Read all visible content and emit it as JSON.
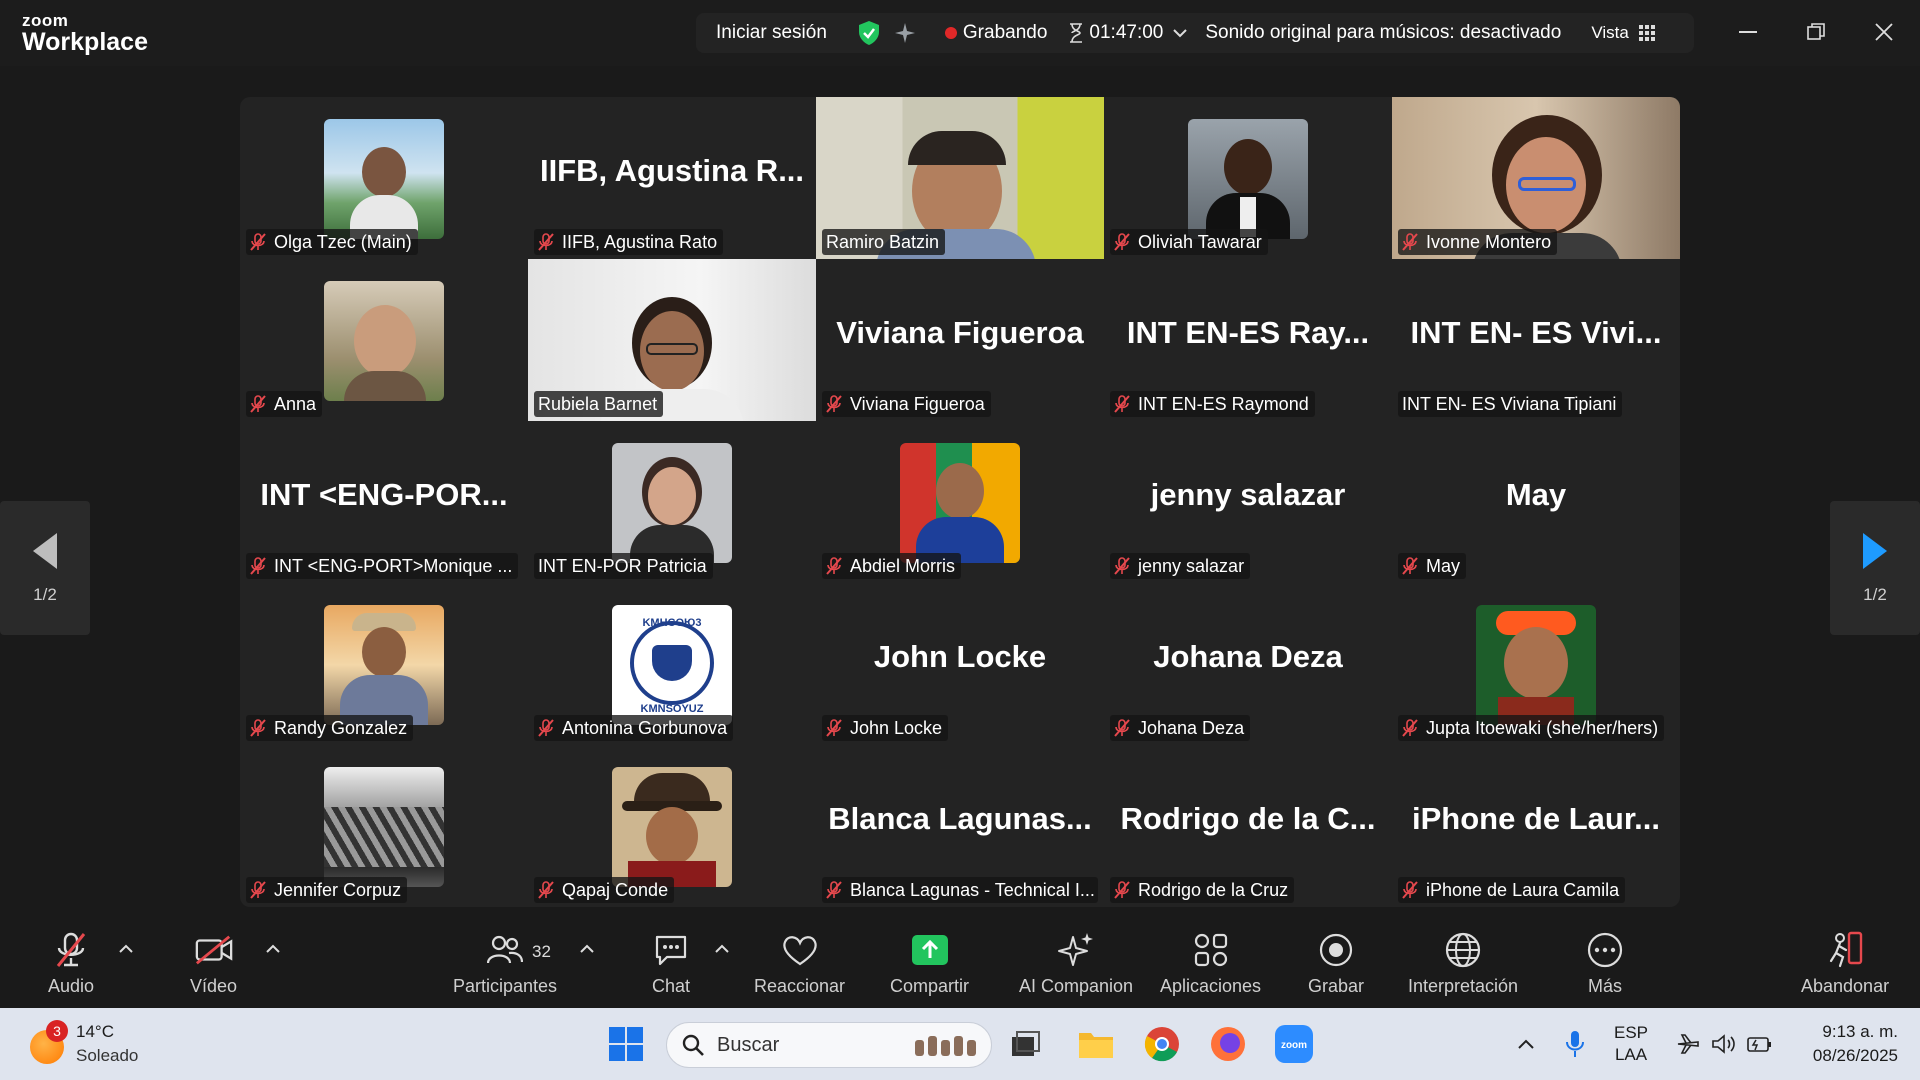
{
  "app": {
    "brand_small": "zoom",
    "brand_big": "Workplace"
  },
  "top_bar": {
    "sign_in": "Iniciar sesión",
    "recording_label": "Grabando",
    "timer": "01:47:00",
    "sound_status": "Sonido original para músicos: desactivado",
    "view_label": "Vista"
  },
  "page_indicator": {
    "left": "1/2",
    "right": "1/2"
  },
  "participants": [
    {
      "label": "Olga Tzec (Main)",
      "big": "",
      "muted": true,
      "kind": "avatar"
    },
    {
      "label": "IIFB, Agustina Rato",
      "big": "IIFB, Agustina R...",
      "muted": true,
      "kind": "name"
    },
    {
      "label": "Ramiro Batzin",
      "big": "",
      "muted": false,
      "kind": "video"
    },
    {
      "label": "Oliviah Tawarar",
      "big": "",
      "muted": true,
      "kind": "avatar"
    },
    {
      "label": "Ivonne Montero",
      "big": "",
      "muted": true,
      "kind": "video"
    },
    {
      "label": "Anna",
      "big": "",
      "muted": true,
      "kind": "avatar"
    },
    {
      "label": "Rubiela Barnet",
      "big": "",
      "muted": false,
      "kind": "video",
      "active": true
    },
    {
      "label": "Viviana Figueroa",
      "big": "Viviana Figueroa",
      "muted": true,
      "kind": "name"
    },
    {
      "label": "INT EN-ES Raymond",
      "big": "INT EN-ES Ray...",
      "muted": true,
      "kind": "name"
    },
    {
      "label": "INT EN- ES Viviana Tipiani",
      "big": "INT EN- ES Vivi...",
      "muted": false,
      "kind": "name"
    },
    {
      "label": "INT <ENG-PORT>Monique ...",
      "big": "INT <ENG-POR...",
      "muted": true,
      "kind": "name"
    },
    {
      "label": "INT EN-POR Patricia",
      "big": "",
      "muted": false,
      "kind": "avatar"
    },
    {
      "label": "Abdiel Morris",
      "big": "",
      "muted": true,
      "kind": "avatar"
    },
    {
      "label": "jenny salazar",
      "big": "jenny salazar",
      "muted": true,
      "kind": "name"
    },
    {
      "label": "May",
      "big": "May",
      "muted": true,
      "kind": "name"
    },
    {
      "label": "Randy Gonzalez",
      "big": "",
      "muted": true,
      "kind": "avatar"
    },
    {
      "label": "Antonina Gorbunova",
      "big": "",
      "muted": true,
      "kind": "avatar"
    },
    {
      "label": "John Locke",
      "big": "John Locke",
      "muted": true,
      "kind": "name"
    },
    {
      "label": "Johana Deza",
      "big": "Johana Deza",
      "muted": true,
      "kind": "name"
    },
    {
      "label": "Jupta Itoewaki (she/her/hers)",
      "big": "",
      "muted": true,
      "kind": "avatar"
    },
    {
      "label": "Jennifer Corpuz",
      "big": "",
      "muted": true,
      "kind": "avatar"
    },
    {
      "label": "Qapaj Conde",
      "big": "",
      "muted": true,
      "kind": "avatar"
    },
    {
      "label": "Blanca Lagunas - Technical I...",
      "big": "Blanca Lagunas...",
      "muted": true,
      "kind": "name"
    },
    {
      "label": "Rodrigo de la Cruz",
      "big": "Rodrigo de la C...",
      "muted": true,
      "kind": "name"
    },
    {
      "label": "iPhone de Laura Camila",
      "big": "iPhone de Laur...",
      "muted": true,
      "kind": "name"
    }
  ],
  "logo_text": {
    "top": "KMHCOЮ3",
    "bottom": "KMNSOYUZ"
  },
  "toolbar": {
    "audio": "Audio",
    "video": "Vídeo",
    "participants": "Participantes",
    "participants_count": "32",
    "chat": "Chat",
    "react": "Reaccionar",
    "share": "Compartir",
    "ai": "AI Companion",
    "apps": "Aplicaciones",
    "record": "Grabar",
    "interpretation": "Interpretación",
    "more": "Más",
    "leave": "Abandonar"
  },
  "taskbar": {
    "weather_badge": "3",
    "temperature": "14°C",
    "condition": "Soleado",
    "search_placeholder": "Buscar",
    "lang_top": "ESP",
    "lang_bottom": "LAA",
    "time": "9:13 a. m.",
    "date": "08/26/2025"
  },
  "colors": {
    "active_speaker": "#22c55e",
    "recording": "#e02828",
    "share": "#22c55e",
    "mute": "#e5484d"
  }
}
